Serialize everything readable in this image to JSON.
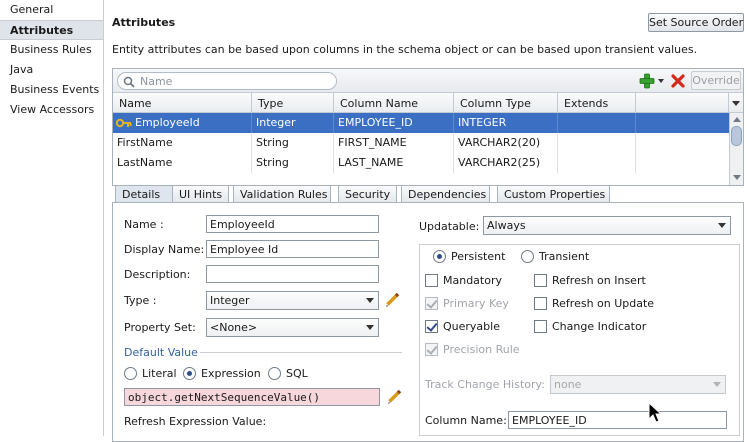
{
  "nav": {
    "items": [
      {
        "label": "General",
        "selected": false
      },
      {
        "label": "Attributes",
        "selected": true
      },
      {
        "label": "Business Rules",
        "selected": false
      },
      {
        "label": "Java",
        "selected": false
      },
      {
        "label": "Business Events",
        "selected": false
      },
      {
        "label": "View Accessors",
        "selected": false
      }
    ]
  },
  "header": {
    "title": "Attributes",
    "set_source_order_label": "Set Source Order",
    "description": "Entity attributes can be based upon columns in the schema object or can be based upon transient values."
  },
  "grid": {
    "search_placeholder": "Name",
    "override_label": "Override",
    "columns": [
      "Name",
      "Type",
      "Column Name",
      "Column Type",
      "Extends"
    ],
    "rows": [
      {
        "name": "EmployeeId",
        "type": "Integer",
        "column_name": "EMPLOYEE_ID",
        "column_type": "INTEGER",
        "extends": "",
        "selected": true,
        "key": true
      },
      {
        "name": "FirstName",
        "type": "String",
        "column_name": "FIRST_NAME",
        "column_type": "VARCHAR2(20)",
        "extends": "",
        "selected": false,
        "key": false
      },
      {
        "name": "LastName",
        "type": "String",
        "column_name": "LAST_NAME",
        "column_type": "VARCHAR2(25)",
        "extends": "",
        "selected": false,
        "key": false
      }
    ]
  },
  "tabs": [
    "Details",
    "UI Hints",
    "Validation Rules",
    "Security",
    "Dependencies",
    "Custom Properties"
  ],
  "details": {
    "name_label": "Name :",
    "name_value": "EmployeeId",
    "display_name_label": "Display Name:",
    "display_name_value": "Employee Id",
    "description_label": "Description:",
    "description_value": "",
    "type_label": "Type :",
    "type_value": "Integer",
    "property_set_label": "Property Set:",
    "property_set_value": "<None>",
    "default_value_title": "Default Value",
    "literal_label": "Literal",
    "expression_label": "Expression",
    "sql_label": "SQL",
    "expression_value": "object.getNextSequenceValue()",
    "refresh_expression_label": "Refresh Expression Value:",
    "updatable_label": "Updatable:",
    "updatable_value": "Always",
    "persistent_label": "Persistent",
    "transient_label": "Transient",
    "mandatory_label": "Mandatory",
    "primary_key_label": "Primary Key",
    "queryable_label": "Queryable",
    "precision_rule_label": "Precision Rule",
    "refresh_on_insert_label": "Refresh on Insert",
    "refresh_on_update_label": "Refresh on Update",
    "change_indicator_label": "Change Indicator",
    "track_change_history_label": "Track Change History:",
    "track_change_history_value": "none",
    "column_name_label": "Column Name:",
    "column_name_value": "EMPLOYEE_ID"
  },
  "colors": {
    "selection": "#3a6fc4",
    "expression_highlight": "#f7d7dc",
    "section_title": "#3560a3"
  }
}
